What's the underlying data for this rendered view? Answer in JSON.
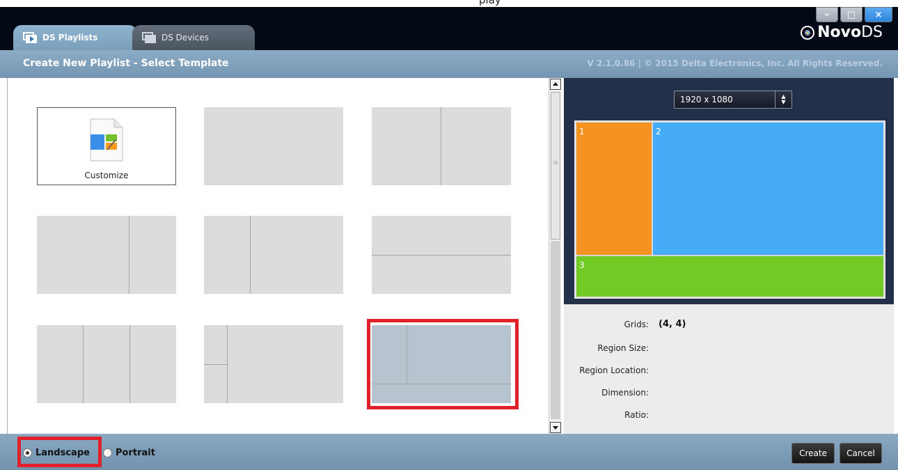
{
  "page_title_fragment": "play",
  "window": {
    "tabs": [
      {
        "label": "DS Playlists"
      },
      {
        "label": "DS Devices"
      }
    ],
    "controls": {
      "minimize": "–",
      "maximize": "□",
      "close": "×"
    },
    "logo": {
      "novo": "Novo",
      "ds": "DS"
    }
  },
  "header": {
    "title": "Create New Playlist - Select Template",
    "version": "V 2.1.0.86  |  © 2015 Delta Electronics, Inc. All Rights Reserved."
  },
  "templates": {
    "customize_label": "Customize",
    "selected_index": 8
  },
  "preview": {
    "resolution": "1920 x 1080",
    "regions": [
      "1",
      "2",
      "3"
    ]
  },
  "info": {
    "grids_label": "Grids:",
    "grids_value": "(4, 4)",
    "region_size_label": "Region Size:",
    "region_location_label": "Region Location:",
    "dimension_label": "Dimension:",
    "ratio_label": "Ratio:"
  },
  "orientation": {
    "landscape": "Landscape",
    "portrait": "Portrait",
    "selected": "landscape"
  },
  "actions": {
    "create": "Create",
    "cancel": "Cancel"
  },
  "colors": {
    "region_1": "#f49321",
    "region_2": "#46acf8",
    "region_3": "#72cb25",
    "highlight": "#e0202b"
  }
}
